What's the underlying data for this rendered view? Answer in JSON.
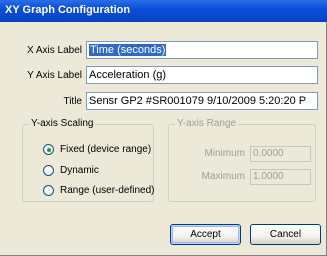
{
  "window": {
    "title": "XY Graph Configuration"
  },
  "fields": {
    "x_axis_label": {
      "label": "X Axis Label",
      "value": "Time (seconds)"
    },
    "y_axis_label": {
      "label": "Y Axis Label",
      "value": "Acceleration (g)"
    },
    "title": {
      "label": "Title",
      "value": "Sensr GP2 #SR001079 9/10/2009 5:20:20 P"
    }
  },
  "y_axis_scaling": {
    "title": "Y-axis Scaling",
    "options": [
      {
        "label": "Fixed (device range)",
        "selected": true
      },
      {
        "label": "Dynamic",
        "selected": false
      },
      {
        "label": "Range (user-defined)",
        "selected": false
      }
    ]
  },
  "y_axis_range": {
    "title": "Y-axis Range",
    "enabled": false,
    "minimum": {
      "label": "Minimum",
      "value": "0.0000"
    },
    "maximum": {
      "label": "Maximum",
      "value": "1.0000"
    }
  },
  "buttons": {
    "accept": "Accept",
    "cancel": "Cancel"
  },
  "colors": {
    "title_bar": "#0a4fd8",
    "dialog_bg": "#ece9d8",
    "selection": "#316ac5",
    "radio_dot": "#21a121"
  }
}
